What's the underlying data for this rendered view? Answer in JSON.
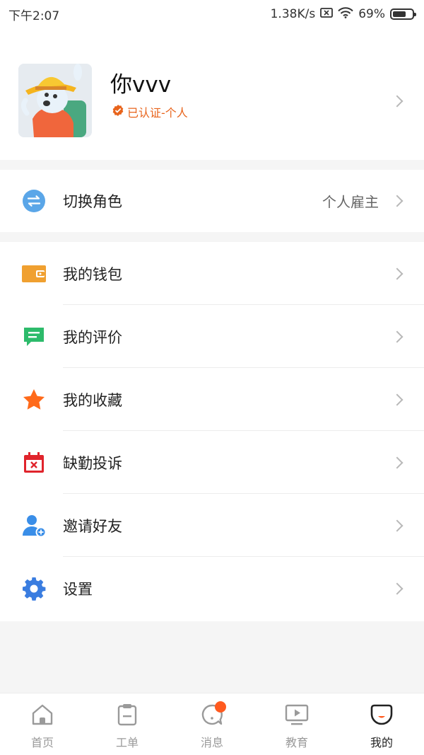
{
  "status_bar": {
    "time": "下午2:07",
    "network_speed": "1.38K/s",
    "battery_percent": "69%",
    "battery_level": 0.69
  },
  "profile": {
    "name": "你vvv",
    "verified_label": "已认证-个人"
  },
  "role_switch": {
    "label": "切换角色",
    "value": "个人雇主"
  },
  "menu": [
    {
      "label": "我的钱包",
      "icon": "wallet-icon"
    },
    {
      "label": "我的评价",
      "icon": "comment-icon"
    },
    {
      "label": "我的收藏",
      "icon": "star-icon"
    },
    {
      "label": "缺勤投诉",
      "icon": "calendar-x-icon"
    },
    {
      "label": "邀请好友",
      "icon": "add-user-icon"
    },
    {
      "label": "设置",
      "icon": "gear-icon"
    }
  ],
  "tabbar": [
    {
      "label": "首页",
      "icon": "home-icon"
    },
    {
      "label": "工单",
      "icon": "clipboard-icon"
    },
    {
      "label": "消息",
      "icon": "message-icon"
    },
    {
      "label": "教育",
      "icon": "video-icon"
    },
    {
      "label": "我的",
      "icon": "profile-icon"
    }
  ],
  "colors": {
    "accent": "#ff5a1f",
    "verified": "#e8641c",
    "wallet": "#f0a030",
    "comment": "#2dbb6b",
    "star": "#ff6a1a",
    "calendar": "#e0242c",
    "user": "#3a8ee8",
    "gear": "#3a7de0"
  }
}
